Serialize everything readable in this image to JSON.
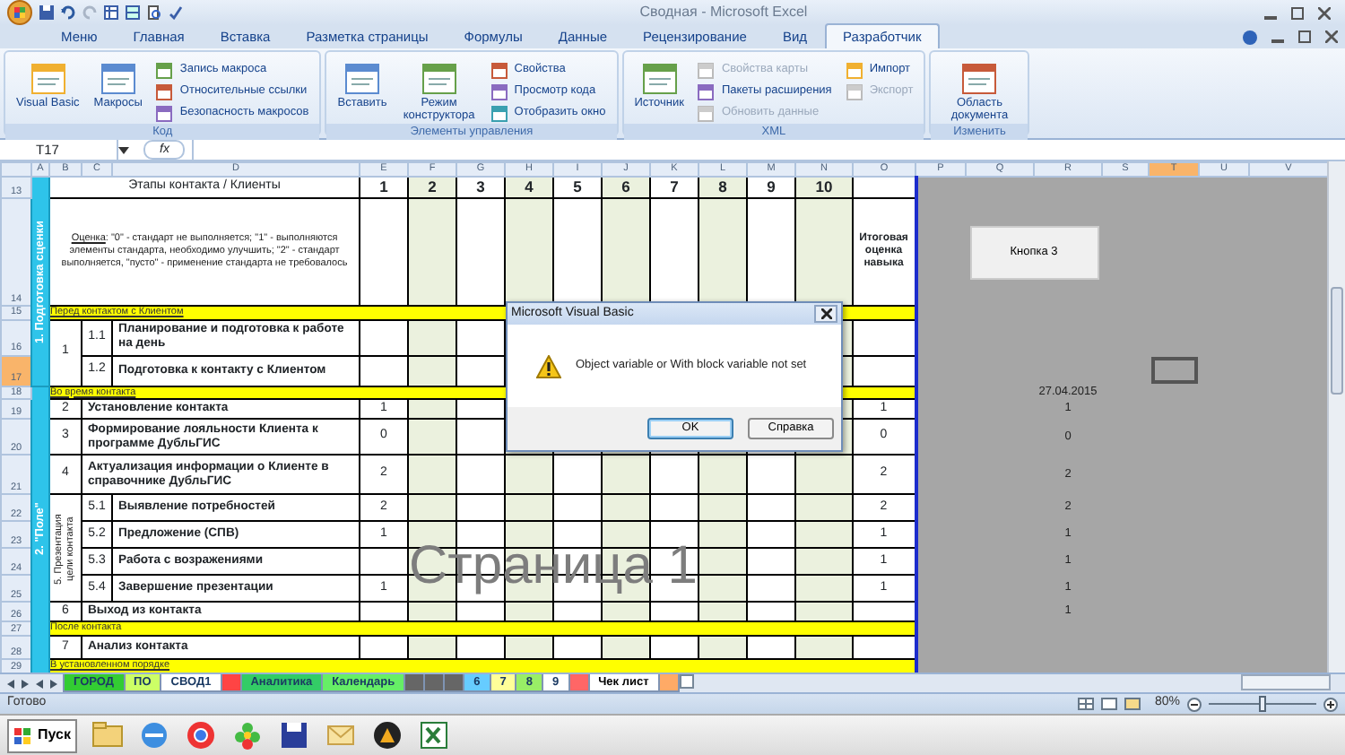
{
  "window": {
    "title": "Сводная - Microsoft Excel"
  },
  "ribbon_tabs": [
    {
      "label": "Меню",
      "selected": false
    },
    {
      "label": "Главная",
      "selected": false
    },
    {
      "label": "Вставка",
      "selected": false
    },
    {
      "label": "Разметка страницы",
      "selected": false
    },
    {
      "label": "Формулы",
      "selected": false
    },
    {
      "label": "Данные",
      "selected": false
    },
    {
      "label": "Рецензирование",
      "selected": false
    },
    {
      "label": "Вид",
      "selected": false
    },
    {
      "label": "Разработчик",
      "selected": true
    }
  ],
  "ribbon_groups": [
    {
      "label": "Код",
      "items": [
        {
          "kind": "large",
          "label": "Visual Basic",
          "disabled": false
        },
        {
          "kind": "large",
          "label": "Макросы",
          "disabled": false
        },
        {
          "kind": "small",
          "label": "Запись макроса",
          "disabled": false
        },
        {
          "kind": "small",
          "label": "Относительные ссылки",
          "disabled": false
        },
        {
          "kind": "small",
          "label": "Безопасность макросов",
          "disabled": false
        }
      ]
    },
    {
      "label": "Элементы управления",
      "items": [
        {
          "kind": "large",
          "label": "Вставить",
          "disabled": false
        },
        {
          "kind": "large",
          "label": "Режим конструктора",
          "disabled": false
        },
        {
          "kind": "small",
          "label": "Свойства",
          "disabled": false
        },
        {
          "kind": "small",
          "label": "Просмотр кода",
          "disabled": false
        },
        {
          "kind": "small",
          "label": "Отобразить окно",
          "disabled": false
        }
      ]
    },
    {
      "label": "XML",
      "items": [
        {
          "kind": "large",
          "label": "Источник",
          "disabled": false
        },
        {
          "kind": "small",
          "label": "Свойства карты",
          "disabled": true
        },
        {
          "kind": "small",
          "label": "Пакеты расширения",
          "disabled": false
        },
        {
          "kind": "small",
          "label": "Обновить данные",
          "disabled": true
        },
        {
          "kind": "small",
          "label": "Импорт",
          "disabled": false
        },
        {
          "kind": "small",
          "label": "Экспорт",
          "disabled": true
        }
      ]
    },
    {
      "label": "Изменить",
      "items": [
        {
          "kind": "large",
          "label": "Область документа",
          "disabled": false
        }
      ]
    }
  ],
  "formula_bar": {
    "name_box": "T17",
    "function_label": "fx"
  },
  "columns": [
    {
      "label": "A",
      "selected": false
    },
    {
      "label": "B",
      "selected": false
    },
    {
      "label": "C",
      "selected": false
    },
    {
      "label": "D",
      "selected": false
    },
    {
      "label": "E",
      "selected": false
    },
    {
      "label": "F",
      "selected": false
    },
    {
      "label": "G",
      "selected": false
    },
    {
      "label": "H",
      "selected": false
    },
    {
      "label": "I",
      "selected": false
    },
    {
      "label": "J",
      "selected": false
    },
    {
      "label": "K",
      "selected": false
    },
    {
      "label": "L",
      "selected": false
    },
    {
      "label": "M",
      "selected": false
    },
    {
      "label": "N",
      "selected": false
    },
    {
      "label": "O",
      "selected": false
    },
    {
      "label": "P",
      "selected": false
    },
    {
      "label": "Q",
      "selected": false
    },
    {
      "label": "R",
      "selected": false
    },
    {
      "label": "S",
      "selected": false
    },
    {
      "label": "T",
      "selected": true
    },
    {
      "label": "U",
      "selected": false
    },
    {
      "label": "V",
      "selected": false
    }
  ],
  "blocks": [
    {
      "band": "1. Подготовка сценки",
      "rows": [
        {
          "kind": "header",
          "num": "13",
          "selected": false,
          "title": "Этапы контакта / Клиенты",
          "clients": [
            "1",
            "2",
            "3",
            "4",
            "5",
            "6",
            "7",
            "8",
            "9",
            "10"
          ]
        },
        {
          "kind": "legend",
          "num": "14",
          "selected": false,
          "label": "Оценка",
          "text": ": \"0\" - стандарт не выполняется; \"1\" - выполняются элементы стандарта, необходимо улучшить; \"2\" - стандарт выполняется, \"пусто\" - применение стандарта не требовалось",
          "total_label": "Итоговая оценка навыка",
          "button": "Кнопка 3"
        },
        {
          "kind": "section",
          "num": "15",
          "selected": false,
          "text": "Перед контактом с Клиентом",
          "underlined": true
        },
        {
          "kind": "group",
          "vertical": false,
          "label": "1",
          "rows": [
            {
              "num": "16",
              "selected": false,
              "sub": "1.1",
              "text": "Планирование и подготовка к работе на день"
            },
            {
              "num": "17",
              "selected": true,
              "sub": "1.2",
              "text": "Подготовка к контакту с Клиентом"
            }
          ]
        }
      ]
    },
    {
      "band": "2. \"Поле\"",
      "rows": [
        {
          "kind": "section",
          "num": "18",
          "selected": false,
          "text": "Во время контакта",
          "underlined": true,
          "side_value": "27.04.2015"
        },
        {
          "kind": "item",
          "num": "19",
          "selected": false,
          "no": "2",
          "text": "Установление контакта",
          "scores": [
            "1"
          ],
          "total": "1",
          "side_value": "1"
        },
        {
          "kind": "item",
          "num": "20",
          "selected": false,
          "no": "3",
          "text": "Формирование лояльности Клиента к программе ДубльГИС",
          "scores": [
            "0"
          ],
          "total": "0",
          "side_value": "0"
        },
        {
          "kind": "item",
          "num": "21",
          "selected": false,
          "no": "4",
          "text": "Актуализация информации о Клиенте в справочнике ДубльГИС",
          "scores": [
            "2"
          ],
          "total": "2",
          "side_value": "2"
        },
        {
          "kind": "group",
          "vertical": true,
          "label": "5. Презентация цели контакта",
          "rows": [
            {
              "num": "22",
              "selected": false,
              "sub": "5.1",
              "text": "Выявление потребностей",
              "scores": [
                "2"
              ],
              "total": "2",
              "side_value": "2"
            },
            {
              "num": "23",
              "selected": false,
              "sub": "5.2",
              "text": "Предложение (СПВ)",
              "scores": [
                "1"
              ],
              "total": "1",
              "side_value": "1"
            },
            {
              "num": "24",
              "selected": false,
              "sub": "5.3",
              "text": "Работа с возражениями",
              "total": "1",
              "side_value": "1"
            },
            {
              "num": "25",
              "selected": false,
              "sub": "5.4",
              "text": "Завершение презентации",
              "scores": [
                "1"
              ],
              "total": "1",
              "side_value": "1"
            }
          ]
        },
        {
          "kind": "item",
          "num": "26",
          "selected": false,
          "no": "6",
          "text": "Выход из контакта",
          "side_value": "1"
        },
        {
          "kind": "section",
          "num": "27",
          "selected": false,
          "text": "После контакта",
          "underlined": false
        },
        {
          "kind": "item",
          "num": "28",
          "selected": false,
          "no": "7",
          "text": "Анализ контакта"
        },
        {
          "kind": "section",
          "num": "29",
          "selected": false,
          "text": "В установленном порядке",
          "underlined": true
        }
      ]
    }
  ],
  "page_label": "Страница 1",
  "dialog": {
    "title": "Microsoft Visual Basic",
    "message": "Object variable or With block variable not set",
    "buttons": [
      {
        "label": "OK",
        "selected": true
      },
      {
        "label": "Справка",
        "selected": false
      }
    ]
  },
  "sheet_tabs": [
    {
      "label": "ГОРОД",
      "color": "#33cc33",
      "selected": false
    },
    {
      "label": "ПО",
      "color": "#ccff66",
      "selected": false
    },
    {
      "label": "СВОД1",
      "selected": false
    },
    {
      "color": "#ff4444",
      "selected": false
    },
    {
      "label": "Аналитика",
      "color": "#33cc66",
      "selected": false
    },
    {
      "label": "Календарь",
      "color": "#66ee66",
      "selected": false
    },
    {
      "color": "#666666",
      "selected": false
    },
    {
      "color": "#666666",
      "selected": false
    },
    {
      "color": "#666666",
      "selected": false
    },
    {
      "label": "6",
      "color": "#66ccff",
      "selected": false
    },
    {
      "label": "7",
      "color": "#ffff99",
      "selected": false
    },
    {
      "label": "8",
      "color": "#99ee66",
      "selected": false
    },
    {
      "label": "9",
      "selected": false
    },
    {
      "color": "#ff6666",
      "selected": false
    },
    {
      "label": "Чек лист",
      "selected": true
    },
    {
      "color": "#ffaa66",
      "selected": false
    }
  ],
  "status_bar": {
    "text": "Готово",
    "zoom": "80%",
    "zoom_slider": {
      "level": 0.5
    }
  },
  "taskbar": {
    "start": "Пуск"
  }
}
